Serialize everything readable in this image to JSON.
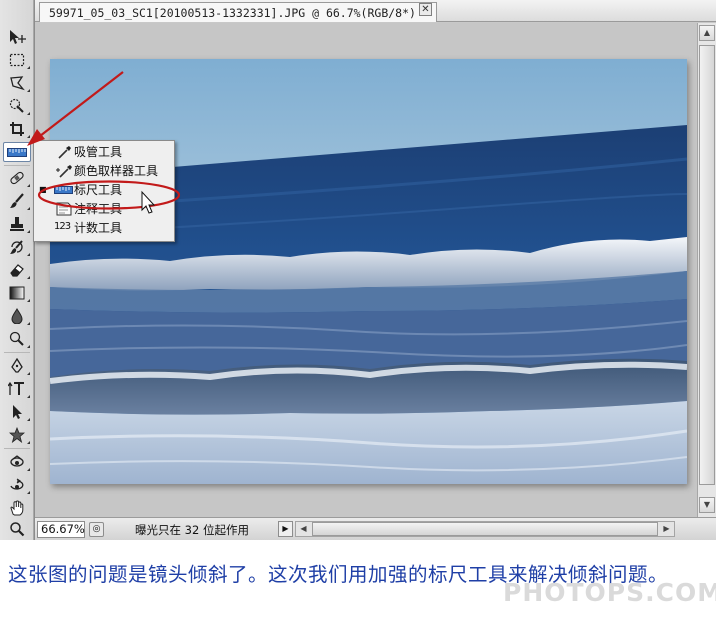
{
  "document": {
    "tab_title": "59971_05_03_SC1[20100513-1332331].JPG @ 66.7%(RGB/8*) *",
    "close_glyph": "✕"
  },
  "toolbox": {
    "tools": [
      {
        "name": "move-tool",
        "icon": "move-icon"
      },
      {
        "name": "marquee-tool",
        "icon": "rect-marquee-icon"
      },
      {
        "name": "lasso-tool",
        "icon": "polygon-lasso-icon"
      },
      {
        "name": "quick-selection-tool",
        "icon": "quick-selection-icon"
      },
      {
        "name": "crop-tool",
        "icon": "crop-icon"
      },
      {
        "name": "ruler-tool",
        "icon": "ruler-icon",
        "active": true
      },
      {
        "name": "healing-brush-tool",
        "icon": "bandage-icon"
      },
      {
        "name": "brush-tool",
        "icon": "brush-icon"
      },
      {
        "name": "clone-stamp-tool",
        "icon": "stamp-icon"
      },
      {
        "name": "history-brush-tool",
        "icon": "history-brush-icon"
      },
      {
        "name": "eraser-tool",
        "icon": "eraser-icon"
      },
      {
        "name": "gradient-tool",
        "icon": "gradient-icon"
      },
      {
        "name": "blur-tool",
        "icon": "drop-icon"
      },
      {
        "name": "dodge-tool",
        "icon": "dodge-icon"
      },
      {
        "name": "pen-tool",
        "icon": "pen-icon"
      },
      {
        "name": "type-tool",
        "icon": "type-icon"
      },
      {
        "name": "path-selection-tool",
        "icon": "arrow-icon"
      },
      {
        "name": "shape-tool",
        "icon": "star-shape-icon"
      },
      {
        "name": "3d-rotate-tool",
        "icon": "3d-rotate-icon"
      },
      {
        "name": "3d-orbit-tool",
        "icon": "3d-orbit-icon"
      },
      {
        "name": "hand-tool",
        "icon": "hand-icon"
      },
      {
        "name": "zoom-tool",
        "icon": "magnifier-icon"
      }
    ]
  },
  "flyout": {
    "items": [
      {
        "label": "吸管工具",
        "icon": "eyedropper-icon",
        "selected": false
      },
      {
        "label": "颜色取样器工具",
        "icon": "color-sampler-icon",
        "selected": false
      },
      {
        "label": "标尺工具",
        "icon": "ruler-icon",
        "selected": true
      },
      {
        "label": "注释工具",
        "icon": "note-icon",
        "selected": false
      },
      {
        "label": "计数工具",
        "icon": "count-icon",
        "selected": false
      }
    ],
    "count_icon_text": "123"
  },
  "status_bar": {
    "zoom": "66.67%",
    "message": "曝光只在 32 位起作用",
    "arrow_glyph": "▶"
  },
  "caption": {
    "text": "这张图的问题是镜头倾斜了。这次我们用加强的标尺工具来解决倾斜问题。"
  },
  "watermark": "PHOTOPS.COM",
  "colors": {
    "annotation_red": "#c21a1a",
    "caption_blue": "#1f3fa6"
  }
}
